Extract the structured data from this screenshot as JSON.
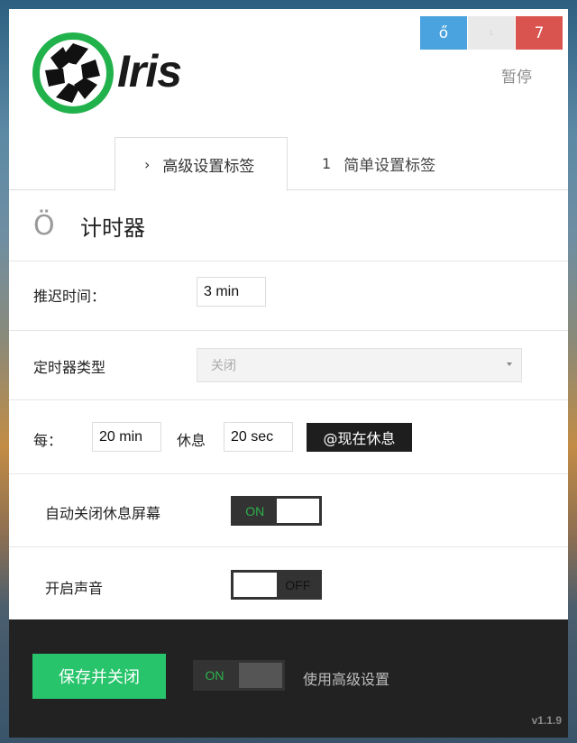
{
  "app": {
    "logo_text": "Iris",
    "window_buttons": {
      "minimize": "ő",
      "maximize": "ι",
      "close": "7"
    },
    "pause_label": "暂停"
  },
  "tabs": [
    {
      "icon": "›",
      "label": "高级设置标签",
      "active": true
    },
    {
      "icon": "1",
      "label": "简单设置标签",
      "active": false
    }
  ],
  "section": {
    "icon": "Ö",
    "title": "计时器"
  },
  "delay": {
    "label": "推迟时间：",
    "value": "3 min"
  },
  "timer_type": {
    "label": "定时器类型",
    "selected": "关闭"
  },
  "every": {
    "label": "每：",
    "interval_value": "20 min",
    "rest_label": "休息",
    "rest_value": "20 sec",
    "break_now_button": "@现在休息"
  },
  "auto_close": {
    "label": "自动关闭休息屏幕",
    "state_text": "ON",
    "state": true
  },
  "sound": {
    "label": "开启声音",
    "state_text": "OFF",
    "state": false
  },
  "footer": {
    "save_button": "保存并关闭",
    "advanced_toggle_text": "ON",
    "advanced_label": "使用高级设置",
    "version": "v1.1.9"
  },
  "colors": {
    "accent_green": "#27c46b",
    "minimize_blue": "#4aa3df",
    "close_red": "#d9534f",
    "footer_bg": "#222222"
  }
}
